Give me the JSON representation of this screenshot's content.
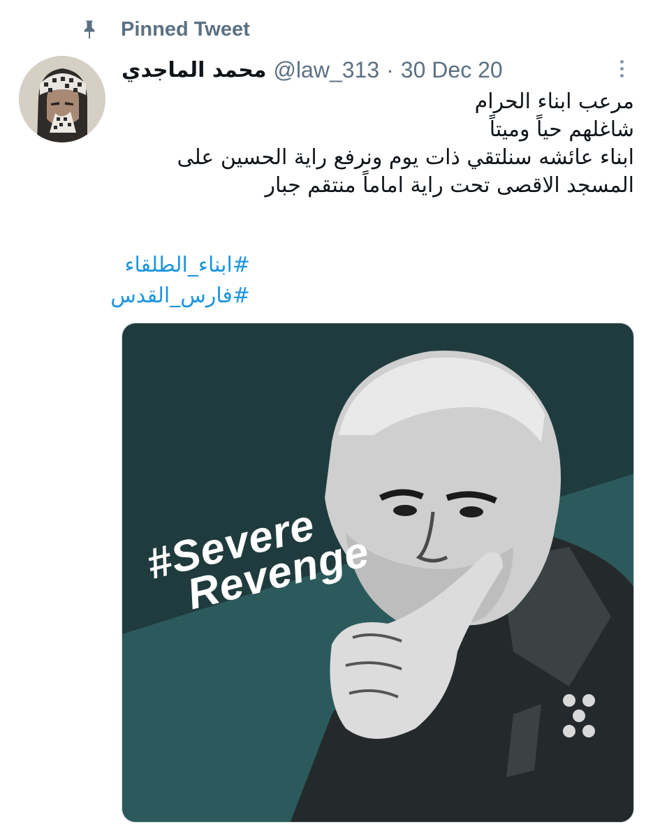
{
  "pinned": {
    "label": "Pinned Tweet",
    "icon": "pin-icon"
  },
  "author": {
    "display_name": "محمد الماجدي",
    "handle": "@law_313",
    "separator": "·",
    "date": "30 Dec 20"
  },
  "tweet": {
    "lines": [
      "مرعب ابناء الحرام",
      "شاغلهم حياً وميتاً",
      "ابناء عائشه سنلتقي ذات يوم ونرفع راية الحسين على",
      "المسجد الاقصى تحت راية اماماً منتقم جبار"
    ],
    "hashtags": [
      "#ابناء_الطلقاء",
      "#فارس_القدس"
    ]
  },
  "media": {
    "line1": "#Severe",
    "line2": "Revenge"
  },
  "colors": {
    "secondary_text": "#5b7083",
    "link": "#1b95e0",
    "media_dark": "#1f3b3e",
    "media_teal": "#2c5a5c"
  }
}
